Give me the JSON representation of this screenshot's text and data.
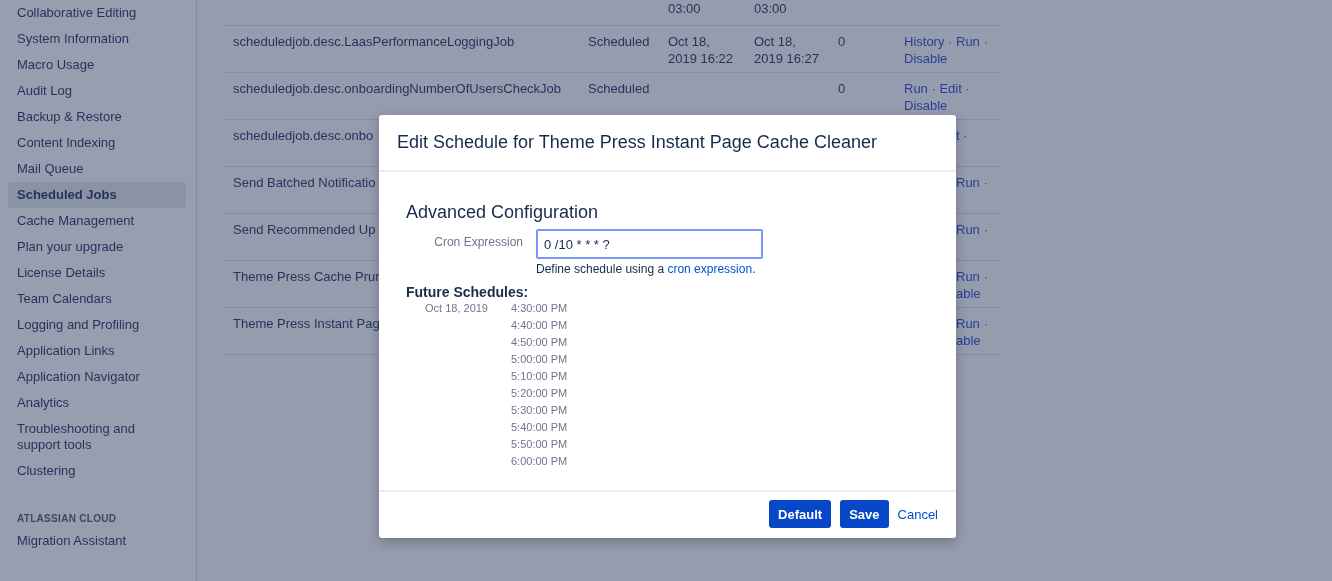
{
  "sidebar": {
    "items": [
      {
        "label": "Collaborative Editing",
        "selected": false
      },
      {
        "label": "System Information",
        "selected": false
      },
      {
        "label": "Macro Usage",
        "selected": false
      },
      {
        "label": "Audit Log",
        "selected": false
      },
      {
        "label": "Backup & Restore",
        "selected": false
      },
      {
        "label": "Content Indexing",
        "selected": false
      },
      {
        "label": "Mail Queue",
        "selected": false
      },
      {
        "label": "Scheduled Jobs",
        "selected": true
      },
      {
        "label": "Cache Management",
        "selected": false
      },
      {
        "label": "Plan your upgrade",
        "selected": false
      },
      {
        "label": "License Details",
        "selected": false
      },
      {
        "label": "Team Calendars",
        "selected": false
      },
      {
        "label": "Logging and Profiling",
        "selected": false
      },
      {
        "label": "Application Links",
        "selected": false
      },
      {
        "label": "Application Navigator",
        "selected": false
      },
      {
        "label": "Analytics",
        "selected": false
      },
      {
        "label": "Troubleshooting and support tools",
        "selected": false
      },
      {
        "label": "Clustering",
        "selected": false
      }
    ],
    "section_heading": "ATLASSIAN CLOUD",
    "section_items": [
      {
        "label": "Migration Assistant",
        "selected": false
      }
    ]
  },
  "table": {
    "rows": [
      {
        "kind": "full",
        "name": "",
        "status": "",
        "next_run": "03:00",
        "last_run": "03:00",
        "count": "",
        "actions": []
      },
      {
        "kind": "full",
        "name": "scheduledjob.desc.LaasPerformanceLoggingJob",
        "status": "Scheduled",
        "next_run": "Oct 18, 2019 16:22",
        "last_run": "Oct 18, 2019 16:27",
        "count": "0",
        "actions": [
          "History · Run ·",
          "Disable"
        ]
      },
      {
        "kind": "full",
        "name": "scheduledjob.desc.onboardingNumberOfUsersCheckJob",
        "status": "Scheduled",
        "next_run": "",
        "last_run": "",
        "count": "0",
        "actions": [
          "Run · Edit ·",
          "Disable"
        ]
      },
      {
        "kind": "partial",
        "name": "scheduledjob.desc.onbo",
        "actions": [
          "t ·"
        ]
      },
      {
        "kind": "partial",
        "name": "Send Batched Notificatio",
        "actions": [
          "Run ·"
        ]
      },
      {
        "kind": "partial",
        "name": "Send Recommended Up",
        "actions": [
          "Run ·"
        ]
      },
      {
        "kind": "partial",
        "name": "Theme Press Cache Prur",
        "actions": [
          "Run ·",
          "able"
        ]
      },
      {
        "kind": "partial",
        "name": "Theme Press Instant Pag",
        "actions": [
          "Run ·",
          "able"
        ]
      }
    ]
  },
  "dialog": {
    "title": "Edit Schedule for Theme Press Instant Page Cache Cleaner",
    "section_title": "Advanced Configuration",
    "field_label": "Cron Expression",
    "field_value": "0 /10 * * * ?",
    "help_text": "Define schedule using a ",
    "help_link": "cron expression",
    "help_end": ".",
    "schedules_title": "Future Schedules:",
    "schedule_date": "Oct 18, 2019",
    "schedule_times": [
      "4:30:00 PM",
      "4:40:00 PM",
      "4:50:00 PM",
      "5:00:00 PM",
      "5:10:00 PM",
      "5:20:00 PM",
      "5:30:00 PM",
      "5:40:00 PM",
      "5:50:00 PM",
      "6:00:00 PM"
    ],
    "buttons": [
      {
        "kind": "primary",
        "label": "Default"
      },
      {
        "kind": "primary",
        "label": "Save"
      },
      {
        "kind": "link",
        "label": "Cancel"
      }
    ]
  }
}
